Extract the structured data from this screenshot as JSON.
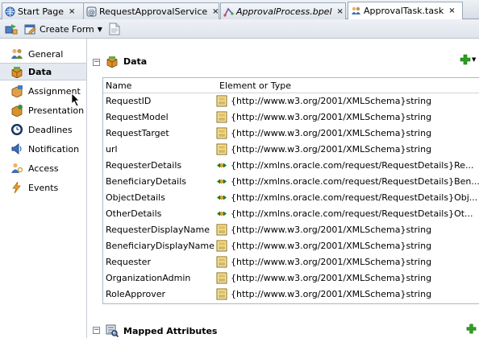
{
  "tabs": [
    {
      "label": "Start Page",
      "italic": false,
      "icon": "globe-icon",
      "active": false
    },
    {
      "label": "RequestApprovalService",
      "italic": false,
      "icon": "service-icon",
      "active": false
    },
    {
      "label": "ApprovalProcess.bpel",
      "italic": true,
      "icon": "bpel-icon",
      "active": false
    },
    {
      "label": "ApprovalTask.task",
      "italic": false,
      "icon": "task-icon",
      "active": true
    }
  ],
  "tab_close_glyph": "×",
  "toolbar": {
    "create_form_label": "Create Form",
    "create_form_caret": "▼"
  },
  "nav": [
    {
      "label": "General",
      "icon": "people-icon"
    },
    {
      "label": "Data",
      "icon": "data-box-icon",
      "active": true
    },
    {
      "label": "Assignment",
      "icon": "assignment-icon"
    },
    {
      "label": "Presentation",
      "icon": "presentation-icon"
    },
    {
      "label": "Deadlines",
      "icon": "clock-icon"
    },
    {
      "label": "Notification",
      "icon": "notification-icon"
    },
    {
      "label": "Access",
      "icon": "access-icon"
    },
    {
      "label": "Events",
      "icon": "lightning-icon"
    }
  ],
  "data_section": {
    "title": "Data",
    "toggle": "−",
    "columns": [
      "Name",
      "Element or Type"
    ],
    "rows": [
      {
        "name": "RequestID",
        "type": "{http://www.w3.org/2001/XMLSchema}string",
        "kind": "simple"
      },
      {
        "name": "RequestModel",
        "type": "{http://www.w3.org/2001/XMLSchema}string",
        "kind": "simple"
      },
      {
        "name": "RequestTarget",
        "type": "{http://www.w3.org/2001/XMLSchema}string",
        "kind": "simple"
      },
      {
        "name": "url",
        "type": "{http://www.w3.org/2001/XMLSchema}string",
        "kind": "simple"
      },
      {
        "name": "RequesterDetails",
        "type": "{http://xmlns.oracle.com/request/RequestDetails}Re...",
        "kind": "element"
      },
      {
        "name": "BeneficiaryDetails",
        "type": "{http://xmlns.oracle.com/request/RequestDetails}Ben...",
        "kind": "element"
      },
      {
        "name": "ObjectDetails",
        "type": "{http://xmlns.oracle.com/request/RequestDetails}Obj...",
        "kind": "element"
      },
      {
        "name": "OtherDetails",
        "type": "{http://xmlns.oracle.com/request/RequestDetails}Ot...",
        "kind": "element"
      },
      {
        "name": "RequesterDisplayName",
        "type": "{http://www.w3.org/2001/XMLSchema}string",
        "kind": "simple"
      },
      {
        "name": "BeneficiaryDisplayName",
        "type": "{http://www.w3.org/2001/XMLSchema}string",
        "kind": "simple"
      },
      {
        "name": "Requester",
        "type": "{http://www.w3.org/2001/XMLSchema}string",
        "kind": "simple"
      },
      {
        "name": "OrganizationAdmin",
        "type": "{http://www.w3.org/2001/XMLSchema}string",
        "kind": "simple"
      },
      {
        "name": "RoleApprover",
        "type": "{http://www.w3.org/2001/XMLSchema}string",
        "kind": "simple"
      }
    ]
  },
  "mapped_section": {
    "title": "Mapped Attributes",
    "toggle": "−"
  },
  "colors": {
    "add_green": "#2f9e20",
    "active_nav_bg": "#e4e9f1"
  }
}
